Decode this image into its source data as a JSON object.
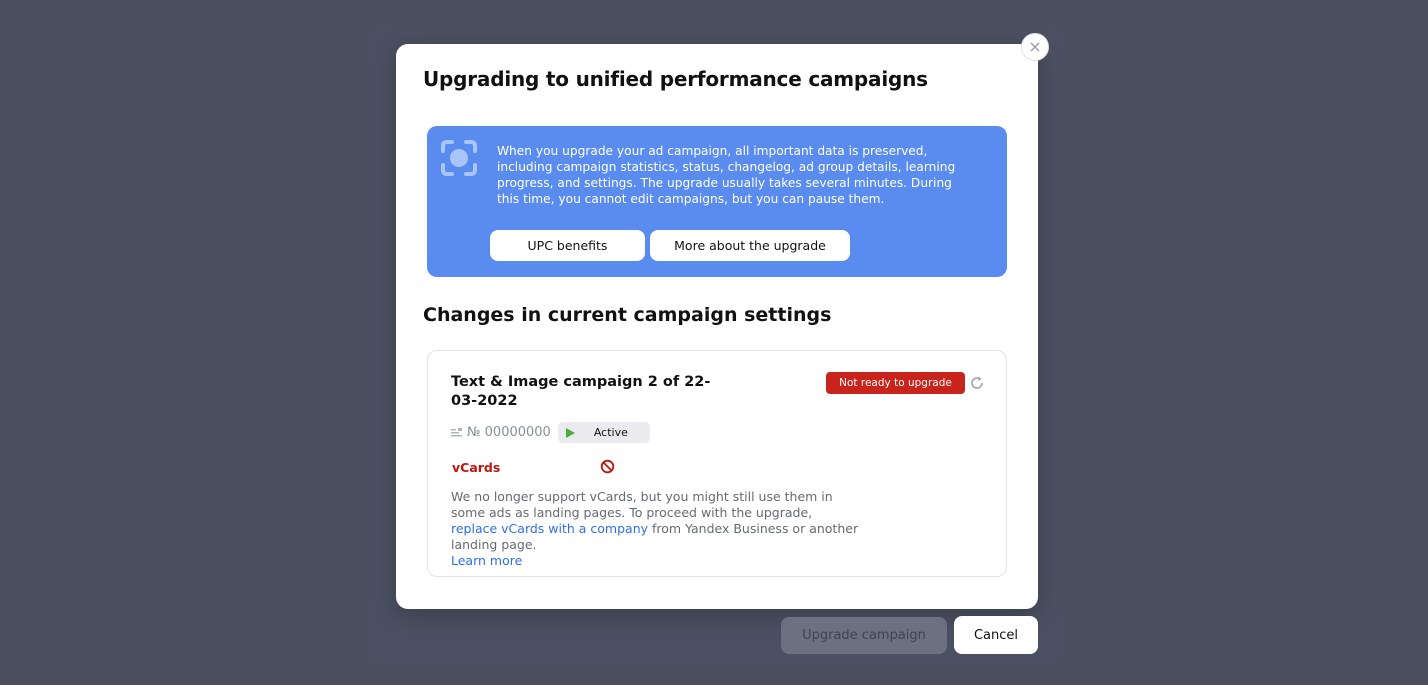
{
  "modal": {
    "title": "Upgrading to unified performance campaigns",
    "close_icon": "close-icon"
  },
  "banner": {
    "icon": "focus-target-icon",
    "text": "When you upgrade your ad campaign, all important data is preserved, including campaign statistics, status, changelog, ad group details, learning progress, and settings. The upgrade usually takes several minutes. During this time, you cannot edit campaigns, but you can pause them.",
    "buttons": {
      "upc_benefits": "UPC benefits",
      "more_about": "More about the upgrade"
    }
  },
  "changes": {
    "title": "Changes in current campaign settings",
    "campaign": {
      "name": "Text & Image campaign 2 of 22-03-2022",
      "status_badge": "Not ready to upgrade",
      "status_badge_color": "#c8241c",
      "id": "№ 00000000",
      "state": "Active",
      "issue": {
        "label": "vCards",
        "label_color": "#c0160d",
        "icon": "ban-icon",
        "text_before": "We no longer support vCards, but you might still use them in some ads as landing pages. To proceed with the upgrade, ",
        "link_text": "replace vCards with a company",
        "text_after": " from Yandex Business or another landing page.",
        "learn_more": "Learn more"
      }
    }
  },
  "footer": {
    "upgrade_label": "Upgrade campaign",
    "cancel_label": "Cancel"
  },
  "colors": {
    "banner_bg": "#5a8cf0",
    "link": "#2f6ee6",
    "overlay": "#4a5060"
  }
}
